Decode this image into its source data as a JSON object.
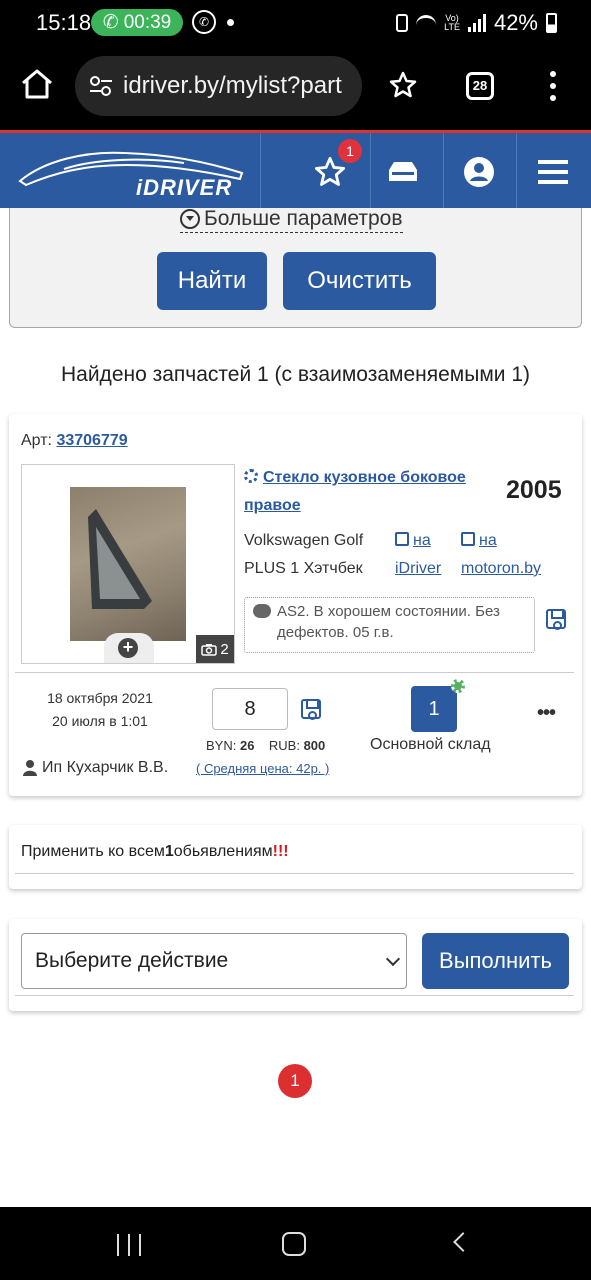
{
  "status_bar": {
    "time": "15:18",
    "call_timer": "00:39",
    "battery": "42%"
  },
  "browser": {
    "url": "idriver.by/mylist?part",
    "tab_count": "28"
  },
  "header": {
    "logo_text": "iDRIVER",
    "favorites_count": "1",
    "icons": [
      "star-icon",
      "car-icon",
      "user-icon",
      "menu-icon"
    ]
  },
  "filter": {
    "more_params": "Больше параметров",
    "find_label": "Найти",
    "clear_label": "Очистить"
  },
  "results": {
    "found_text": "Найдено запчастей 1 (с взаимозаменяемыми 1)"
  },
  "card": {
    "art_prefix": "Арт:",
    "art_number": "33706779",
    "photo_count": "2",
    "part_name": "Стекло кузовное боковое правое",
    "year": "2005",
    "car_model": "Volkswagen Golf PLUS 1 Хэтчбек",
    "link_idriver_top": "на",
    "link_idriver_bottom": "iDriver",
    "link_motoron_top": "на",
    "link_motoron_bottom": "motoron.by",
    "comment": "AS2. В хорошем состоянии. Без дефектов. 05 г.в.",
    "date_created": "18 октября 2021",
    "date_updated": "20 июля в 1:01",
    "seller": "Ип Кухарчик В.В.",
    "quantity": "8",
    "price_byn_label": "BYN:",
    "price_byn": "26",
    "price_rub_label": "RUB:",
    "price_rub": "800",
    "avg_price": "( Средняя цена: 42р. )",
    "stock_count": "1",
    "stock_name": "Основной склад",
    "more_label": "•••"
  },
  "apply": {
    "text_before": "Применить ко всем",
    "count": "1",
    "text_after": "обьявлениям",
    "exclaim": "!!!"
  },
  "action": {
    "select_value": "Выберите действие",
    "execute_label": "Выполнить"
  },
  "pagination": {
    "current_page": "1"
  },
  "colors": {
    "brand_blue": "#2c5aa0",
    "badge_red": "#dc3030",
    "stock_green": "#56b260"
  }
}
